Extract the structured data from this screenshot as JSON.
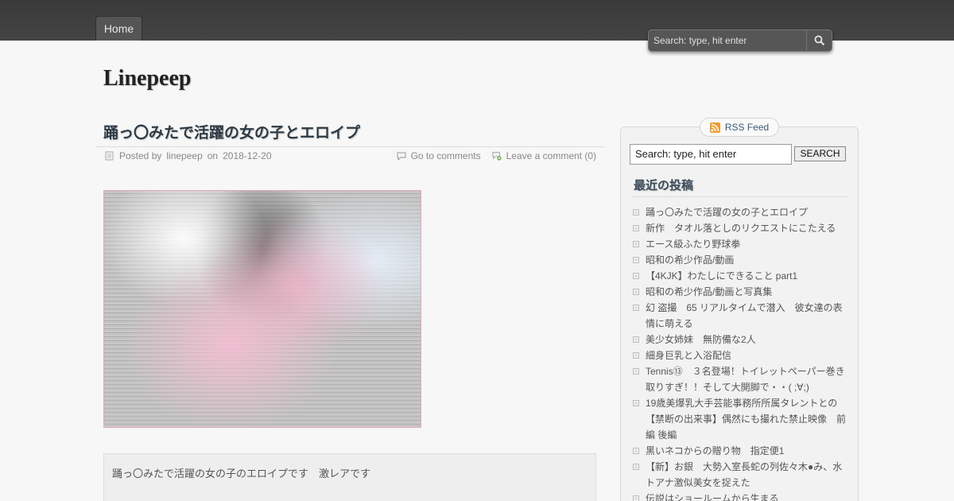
{
  "nav": {
    "home_label": "Home"
  },
  "top_search": {
    "placeholder": "Search: type, hit enter"
  },
  "site": {
    "title": "Linepeep"
  },
  "post": {
    "title": "踊っ〇みたで活躍の女の子とエロイプ",
    "meta": {
      "posted_by_prefix": "Posted by",
      "author": "linepeep",
      "on": "on",
      "date": "2018-12-20",
      "go_to_comments": "Go to comments",
      "leave_comment": "Leave a comment (0)"
    },
    "excerpt": "踊っ〇みたで活躍の女の子のエロイプです　激レアです"
  },
  "sidebar": {
    "rss_label": "RSS Feed",
    "search": {
      "value": "Search: type, hit enter",
      "button_label": "SEARCH"
    },
    "recent_title": "最近の投稿",
    "recent_posts": [
      "踊っ〇みたで活躍の女の子とエロイプ",
      "新作　タオル落としのリクエストにこたえる",
      "エース級ふたり野球拳",
      "昭和の希少作品/動画",
      "【4KJK】わたしにできること part1",
      "昭和の希少作品/動画と写真集",
      "幻 盗撮　65 リアルタイムで潜入　彼女達の表情に萌える",
      "美少女姉妹　無防備な2人",
      "細身巨乳と入浴配信",
      "Tennis⑬　３名登場！トイレットペーパー巻き取りすぎ！！そして大開脚で・・( ;∀;)",
      "19歳美爆乳大手芸能事務所所属タレントとの【禁断の出来事】偶然にも撮れた禁止映像　前編 後編",
      "黒いネコからの贈り物　指定便1",
      "【新】お銀　大勢入室長蛇の列佐々木●み、水トアナ激似美女を捉えた",
      "伝説はショールームから生まる"
    ]
  },
  "icons": {
    "search": "search-icon",
    "rss": "rss-icon",
    "author": "post-author-icon",
    "comments": "comments-icon",
    "add_comment": "add-comment-icon",
    "bullet": "list-bullet-icon"
  }
}
